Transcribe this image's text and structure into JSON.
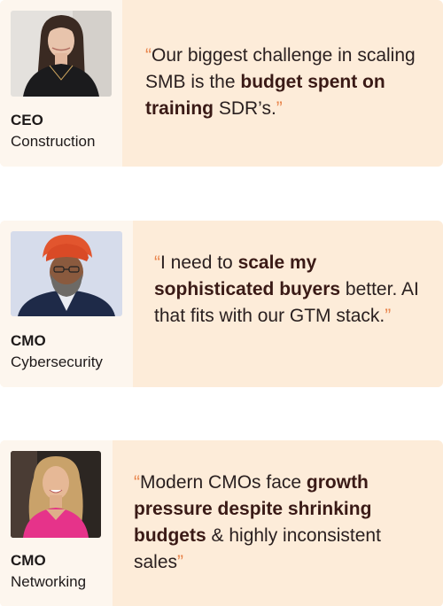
{
  "testimonials": [
    {
      "role": "CEO",
      "industry": "Construction",
      "open_quote": "“",
      "close_quote": "”",
      "quote": {
        "t1": "Our biggest challenge in scaling SMB is the ",
        "b1": "budget spent on training",
        "t2": " SDR’s."
      }
    },
    {
      "role": "CMO",
      "industry": "Cybersecurity",
      "open_quote": "“",
      "close_quote": "”",
      "quote": {
        "t1": "I need to ",
        "b1": "scale my sophisticated buyers",
        "t2": " better. AI that fits with our GTM stack."
      }
    },
    {
      "role": "CMO",
      "industry": "Networking",
      "open_quote": "“",
      "close_quote": "”",
      "quote": {
        "t1": "Modern CMOs face ",
        "b1": "growth pressure despite shrinking budgets",
        "t2": " & highly inconsistent sales"
      }
    }
  ],
  "colors": {
    "card_bg": "#fdecd9",
    "side_bg": "#fdf6ee",
    "quote_mark": "#e8834a",
    "text": "#2a2020"
  }
}
